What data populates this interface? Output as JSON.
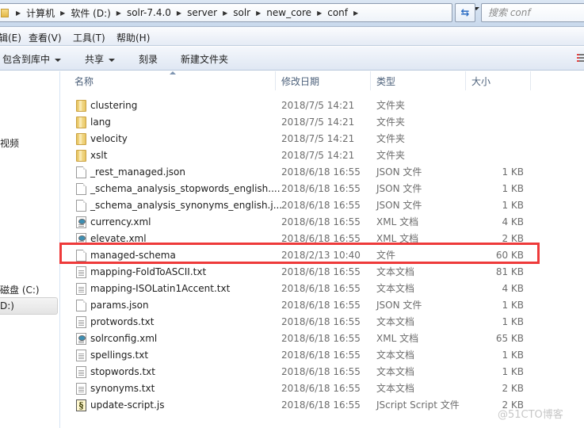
{
  "address_bar": {
    "crumbs": [
      "计算机",
      "软件 (D:)",
      "solr-7.4.0",
      "server",
      "solr",
      "new_core",
      "conf"
    ],
    "refresh_icon": "refresh-icon",
    "dropdown_icon": "chevron-down-icon"
  },
  "search": {
    "placeholder": "搜索 conf"
  },
  "menubar": {
    "items": [
      "辑(E)",
      "查看(V)",
      "工具(T)",
      "帮助(H)"
    ]
  },
  "commandbar": {
    "include_library": "包含到库中",
    "share": "共享",
    "burn": "刻录",
    "new_folder": "新建文件夹",
    "view_icon": "view-options-icon"
  },
  "nav": {
    "items": [
      "视频",
      "磁盘 (C:)",
      "D:)"
    ],
    "selected": "D:)"
  },
  "columns": {
    "name": "名称",
    "date": "修改日期",
    "type": "类型",
    "size": "大小"
  },
  "files": [
    {
      "name": "clustering",
      "date": "2018/7/5 14:21",
      "type": "文件夹",
      "size": "",
      "icon": "folder-icon"
    },
    {
      "name": "lang",
      "date": "2018/7/5 14:21",
      "type": "文件夹",
      "size": "",
      "icon": "folder-icon"
    },
    {
      "name": "velocity",
      "date": "2018/7/5 14:21",
      "type": "文件夹",
      "size": "",
      "icon": "folder-icon"
    },
    {
      "name": "xslt",
      "date": "2018/7/5 14:21",
      "type": "文件夹",
      "size": "",
      "icon": "folder-icon"
    },
    {
      "name": "_rest_managed.json",
      "date": "2018/6/18 16:55",
      "type": "JSON 文件",
      "size": "1 KB",
      "icon": "file-icon"
    },
    {
      "name": "_schema_analysis_stopwords_english....",
      "date": "2018/6/18 16:55",
      "type": "JSON 文件",
      "size": "1 KB",
      "icon": "file-icon"
    },
    {
      "name": "_schema_analysis_synonyms_english.j...",
      "date": "2018/6/18 16:55",
      "type": "JSON 文件",
      "size": "1 KB",
      "icon": "file-icon"
    },
    {
      "name": "currency.xml",
      "date": "2018/6/18 16:55",
      "type": "XML 文档",
      "size": "4 KB",
      "icon": "xml-file-icon"
    },
    {
      "name": "elevate.xml",
      "date": "2018/6/18 16:55",
      "type": "XML 文档",
      "size": "2 KB",
      "icon": "xml-file-icon"
    },
    {
      "name": "managed-schema",
      "date": "2018/2/13 10:40",
      "type": "文件",
      "size": "60 KB",
      "icon": "file-icon",
      "highlighted": true
    },
    {
      "name": "mapping-FoldToASCII.txt",
      "date": "2018/6/18 16:55",
      "type": "文本文档",
      "size": "81 KB",
      "icon": "text-file-icon"
    },
    {
      "name": "mapping-ISOLatin1Accent.txt",
      "date": "2018/6/18 16:55",
      "type": "文本文档",
      "size": "4 KB",
      "icon": "text-file-icon"
    },
    {
      "name": "params.json",
      "date": "2018/6/18 16:55",
      "type": "JSON 文件",
      "size": "1 KB",
      "icon": "file-icon"
    },
    {
      "name": "protwords.txt",
      "date": "2018/6/18 16:55",
      "type": "文本文档",
      "size": "1 KB",
      "icon": "text-file-icon"
    },
    {
      "name": "solrconfig.xml",
      "date": "2018/6/18 16:55",
      "type": "XML 文档",
      "size": "65 KB",
      "icon": "xml-file-icon"
    },
    {
      "name": "spellings.txt",
      "date": "2018/6/18 16:55",
      "type": "文本文档",
      "size": "1 KB",
      "icon": "text-file-icon"
    },
    {
      "name": "stopwords.txt",
      "date": "2018/6/18 16:55",
      "type": "文本文档",
      "size": "1 KB",
      "icon": "text-file-icon"
    },
    {
      "name": "synonyms.txt",
      "date": "2018/6/18 16:55",
      "type": "文本文档",
      "size": "2 KB",
      "icon": "text-file-icon"
    },
    {
      "name": "update-script.js",
      "date": "2018/6/18 16:55",
      "type": "JScript Script 文件",
      "size": "2 KB",
      "icon": "jscript-file-icon"
    }
  ],
  "highlight_color": "#ee3a3a",
  "watermark": "@51CTO博客"
}
